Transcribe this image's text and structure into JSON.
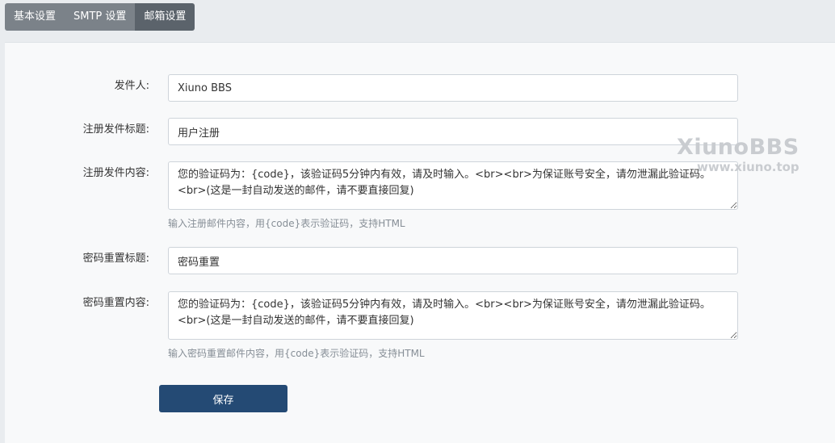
{
  "tabs": [
    {
      "label": "基本设置",
      "active": false
    },
    {
      "label": "SMTP 设置",
      "active": false
    },
    {
      "label": "邮箱设置",
      "active": true
    }
  ],
  "form": {
    "sender": {
      "label": "发件人:",
      "value": "Xiuno BBS"
    },
    "register_subject": {
      "label": "注册发件标题:",
      "value": "用户注册"
    },
    "register_content": {
      "label": "注册发件内容:",
      "value": "您的验证码为：{code}，该验证码5分钟内有效，请及时输入。<br><br>为保证账号安全，请勿泄漏此验证码。<br>(这是一封自动发送的邮件，请不要直接回复)",
      "help": "输入注册邮件内容，用{code}表示验证码，支持HTML"
    },
    "reset_subject": {
      "label": "密码重置标题:",
      "value": "密码重置"
    },
    "reset_content": {
      "label": "密码重置内容:",
      "value": "您的验证码为：{code}，该验证码5分钟内有效，请及时输入。<br><br>为保证账号安全，请勿泄漏此验证码。<br>(这是一封自动发送的邮件，请不要直接回复)",
      "help": "输入密码重置邮件内容，用{code}表示验证码，支持HTML"
    },
    "save_label": "保存"
  },
  "watermark": {
    "title": "XiunoBBS",
    "url": "www.xiuno.top"
  }
}
